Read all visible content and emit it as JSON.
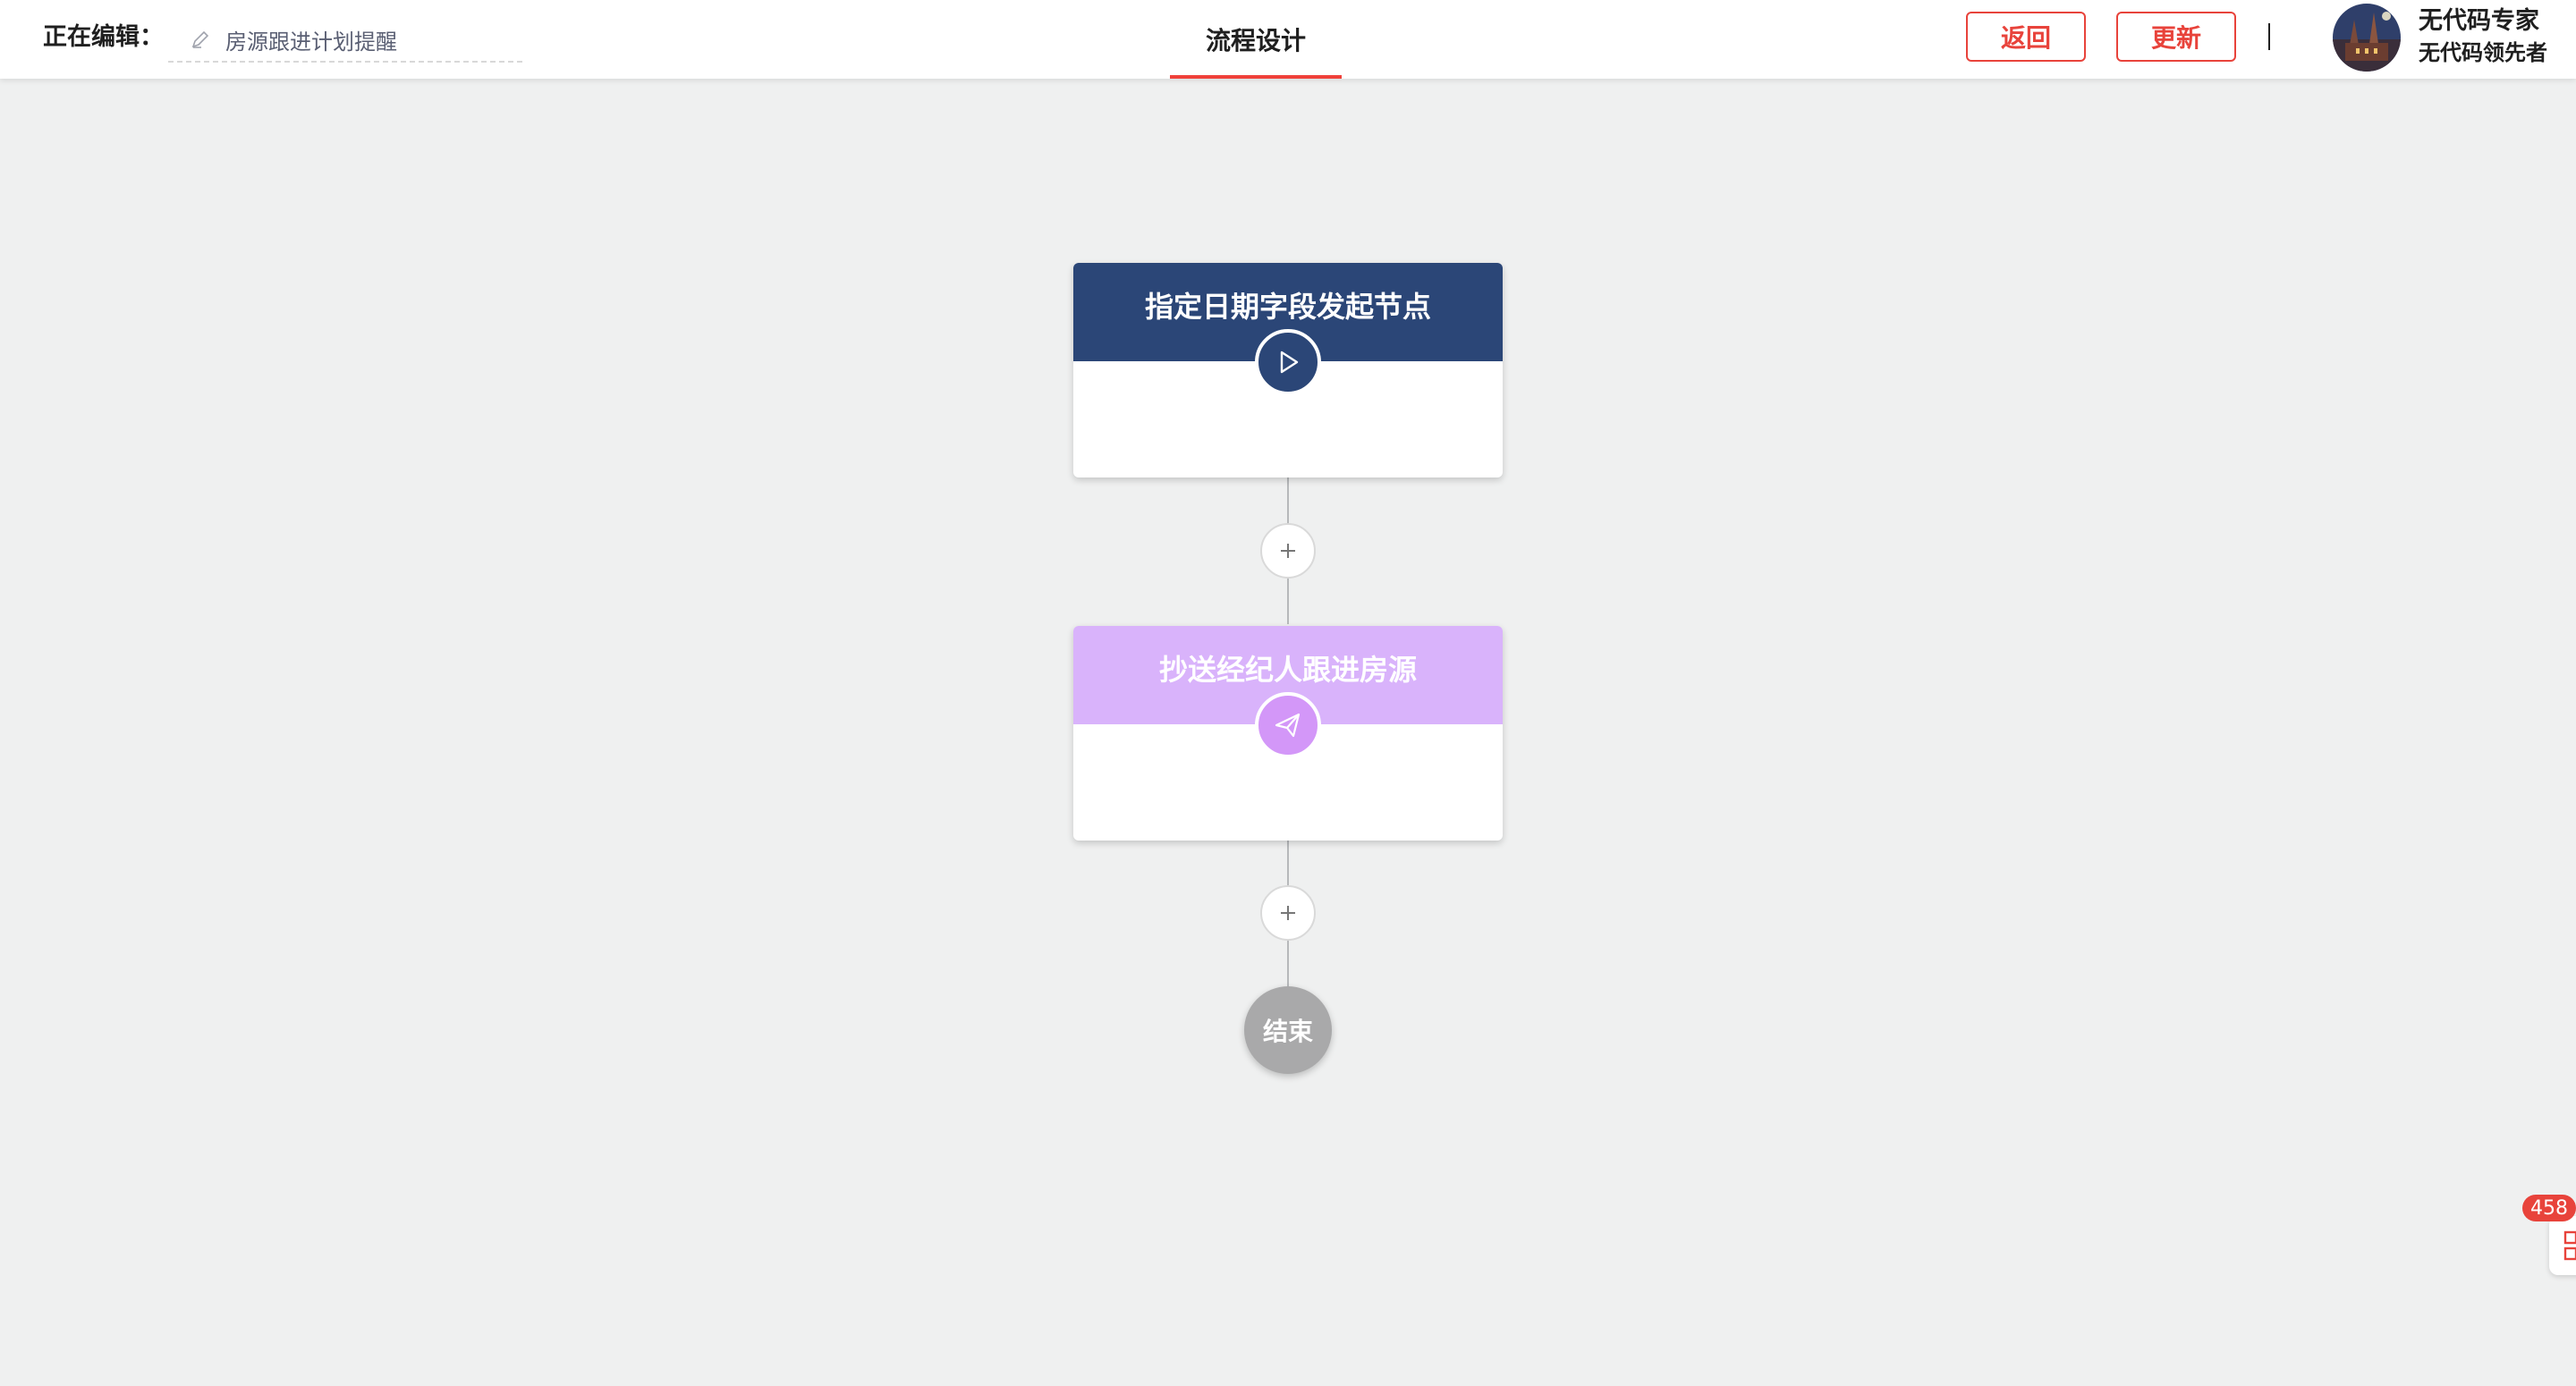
{
  "header": {
    "editing_label": "正在编辑：",
    "editing_name": "房源跟进计划提醒",
    "center_tab": "流程设计",
    "back_label": "返回",
    "update_label": "更新",
    "user_name": "无代码专家",
    "user_subtitle": "无代码领先者"
  },
  "flow": {
    "trigger_node_title": "指定日期字段发起节点",
    "cc_node_title": "抄送经纪人跟进房源",
    "end_label": "结束",
    "trigger_color": "#2b4677",
    "cc_color": "#d9b3fb",
    "cc_icon_color": "#d397f8"
  },
  "floating": {
    "badge_count": "458"
  },
  "colors": {
    "accent": "#e8433b",
    "canvas": "#eff0f0"
  }
}
